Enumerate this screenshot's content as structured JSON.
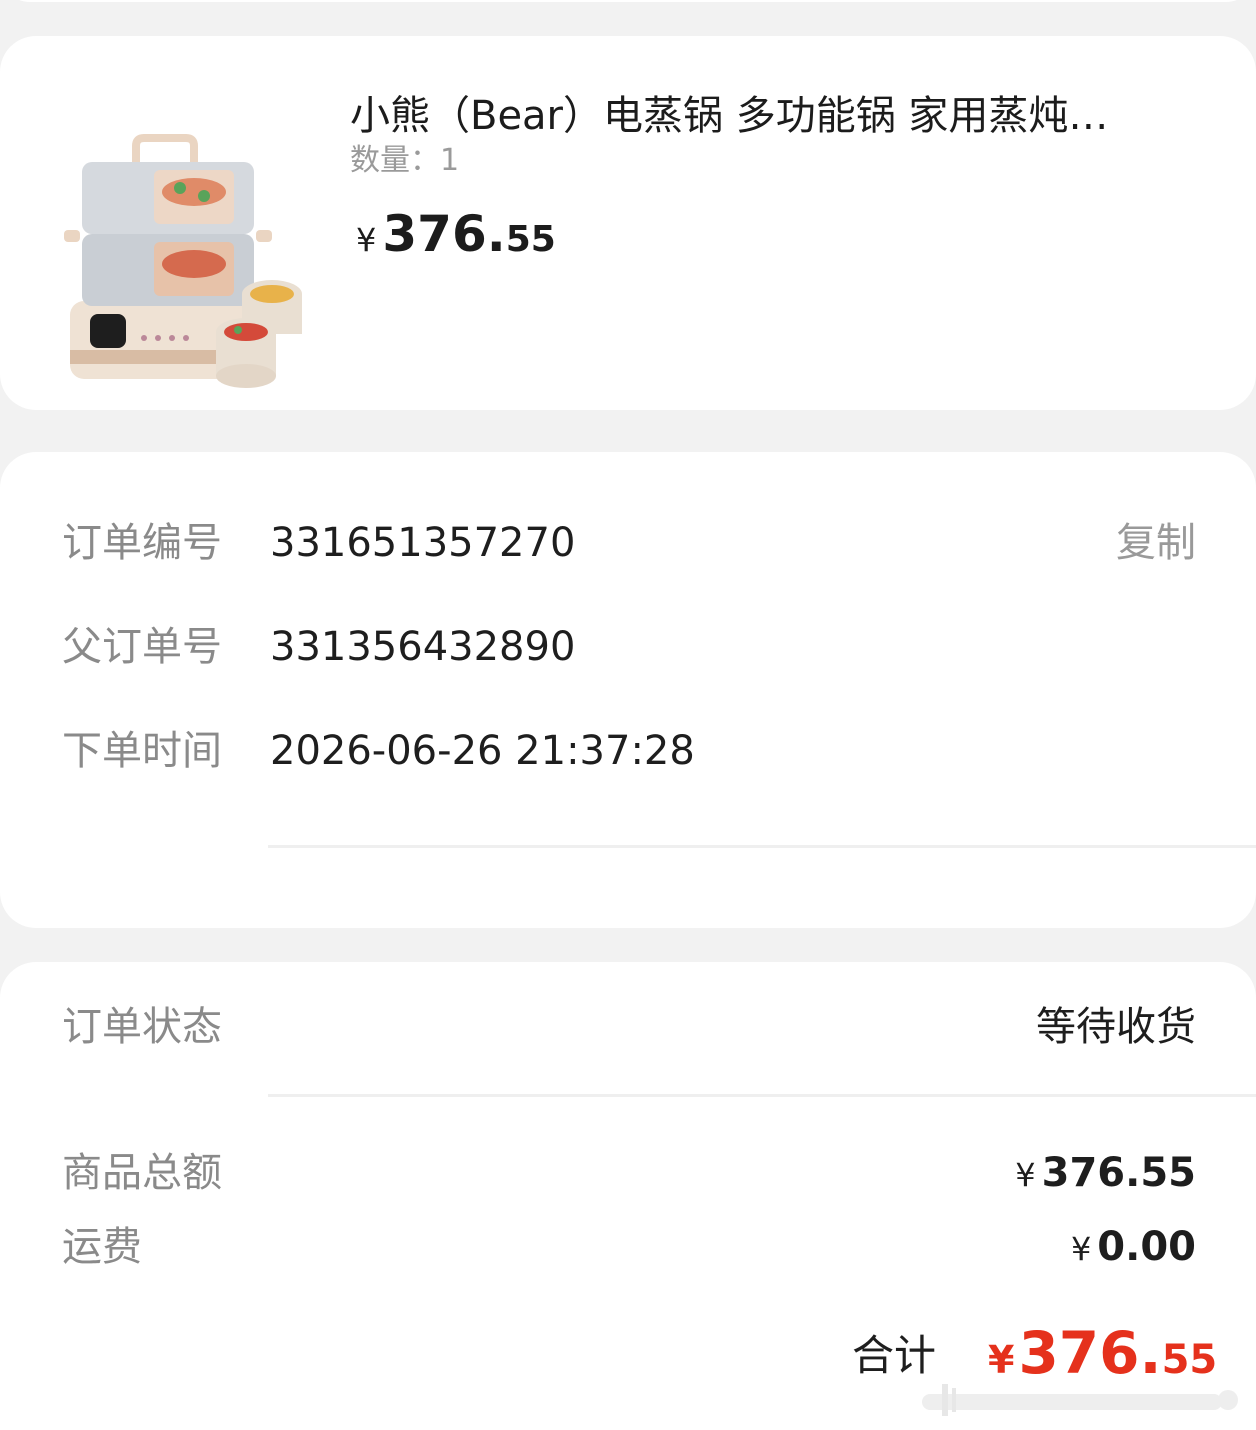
{
  "product": {
    "title": "小熊（Bear）电蒸锅 多功能锅 家用蒸炖…",
    "quantity_label": "数量：",
    "quantity_value": "1",
    "price_currency": "¥",
    "price_integer": "376",
    "price_dot": ".",
    "price_decimal": "55"
  },
  "order_info": {
    "order_number_label": "订单编号",
    "order_number_value": "331651357270",
    "copy_label": "复制",
    "parent_order_label": "父订单号",
    "parent_order_value": "331356432890",
    "order_time_label": "下单时间",
    "order_time_value": "2026-06-26 21:37:28"
  },
  "status": {
    "status_label": "订单状态",
    "status_value": "等待收货",
    "goods_total_label": "商品总额",
    "goods_total_currency": "¥",
    "goods_total_value": "376.55",
    "shipping_label": "运费",
    "shipping_currency": "¥",
    "shipping_value": "0.00",
    "total_label": "合计",
    "total_currency": "¥",
    "total_integer": "376",
    "total_dot": ".",
    "total_decimal": "55"
  },
  "colors": {
    "accent_red": "#e5311c",
    "label_gray": "#8a8a8a",
    "background": "#f2f2f2"
  },
  "icons": {
    "product_image": "electric-steamer-image",
    "watermark": "watermark-icon"
  }
}
